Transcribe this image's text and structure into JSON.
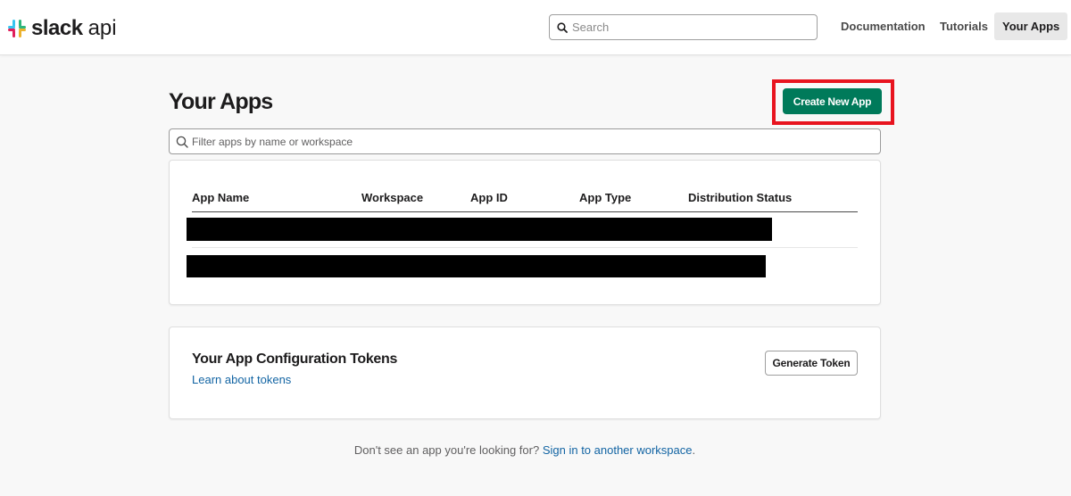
{
  "header": {
    "logo_slack": "slack",
    "logo_api": "api",
    "search_placeholder": "Search",
    "nav": {
      "documentation": "Documentation",
      "tutorials": "Tutorials",
      "your_apps": "Your Apps"
    }
  },
  "main": {
    "title": "Your Apps",
    "create_button": "Create New App",
    "filter_placeholder": "Filter apps by name or workspace",
    "table": {
      "columns": [
        "App Name",
        "Workspace",
        "App ID",
        "App Type",
        "Distribution Status"
      ]
    },
    "tokens": {
      "title": "Your App Configuration Tokens",
      "learn_link": "Learn about tokens",
      "generate_button": "Generate Token"
    },
    "footer": {
      "text": "Don't see an app you're looking for?",
      "link": "Sign in to another workspace",
      "suffix": "."
    }
  },
  "colors": {
    "brand_green": "#007a5a",
    "link_blue": "#1264a3",
    "highlight_red": "#e8141f"
  }
}
